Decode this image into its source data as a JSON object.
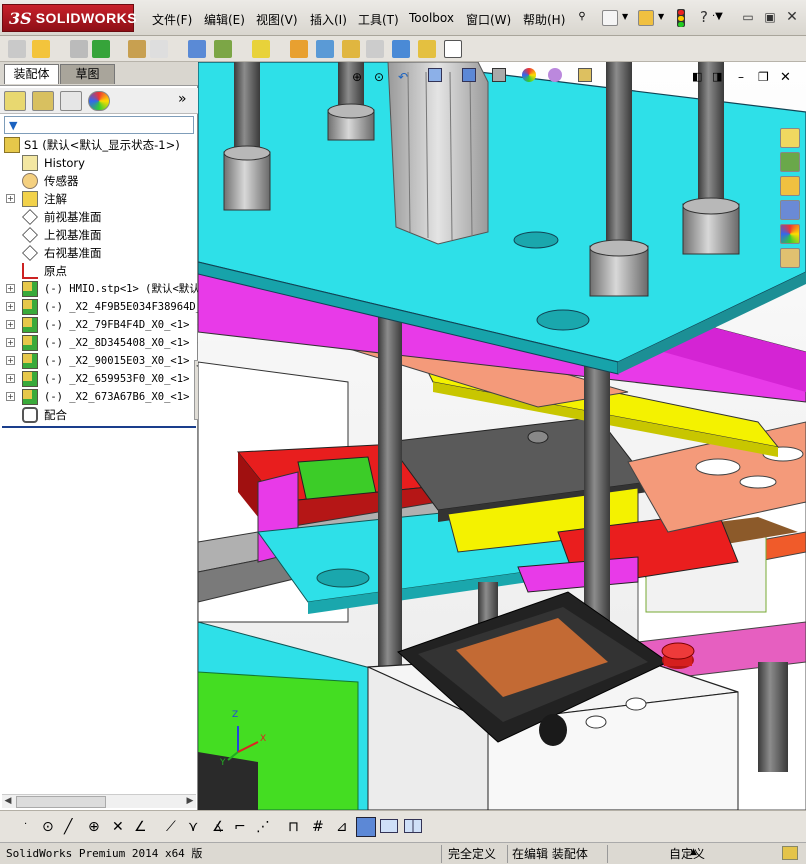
{
  "app": {
    "logo_ds": "3S",
    "logo_name": "SOLIDWORKS"
  },
  "menu": [
    {
      "id": "file",
      "label": "文件(F)"
    },
    {
      "id": "edit",
      "label": "编辑(E)"
    },
    {
      "id": "view",
      "label": "视图(V)"
    },
    {
      "id": "insert",
      "label": "插入(I)"
    },
    {
      "id": "tools",
      "label": "工具(T)"
    },
    {
      "id": "toolbox",
      "label": "Toolbox"
    },
    {
      "id": "window",
      "label": "窗口(W)"
    },
    {
      "id": "help",
      "label": "帮助(H)"
    }
  ],
  "panel": {
    "tabs": [
      "装配体",
      "草图"
    ],
    "filter_icon": "funnel-icon",
    "collapse_glyph": "»"
  },
  "tree": {
    "root": "S1  (默认<默认_显示状态-1>)",
    "items": [
      {
        "label": "History",
        "icon": "history-icon",
        "expandable": false
      },
      {
        "label": "传感器",
        "icon": "sensor-icon",
        "expandable": false
      },
      {
        "label": "注解",
        "icon": "annotation-icon",
        "expandable": true
      },
      {
        "label": "前视基准面",
        "icon": "plane-icon",
        "expandable": false
      },
      {
        "label": "上视基准面",
        "icon": "plane-icon",
        "expandable": false
      },
      {
        "label": "右视基准面",
        "icon": "plane-icon",
        "expandable": false
      },
      {
        "label": "原点",
        "icon": "origin-icon",
        "expandable": false
      },
      {
        "label": "(-) HMIO.stp<1> (默认<默认",
        "icon": "part-icon",
        "expandable": true
      },
      {
        "label": "(-) _X2_4F9B5E034F38964D_",
        "icon": "part-icon",
        "expandable": true
      },
      {
        "label": "(-) _X2_79FB4F4D_X0_<1> (",
        "icon": "part-icon",
        "expandable": true
      },
      {
        "label": "(-) _X2_8D345408_X0_<1> (",
        "icon": "part-icon",
        "expandable": true
      },
      {
        "label": "(-) _X2_90015E03_X0_<1> (",
        "icon": "part-icon",
        "expandable": true
      },
      {
        "label": "(-) _X2_659953F0_X0_<1> (",
        "icon": "part-icon",
        "expandable": true
      },
      {
        "label": "(-) _X2_673A67B6_X0_<1> (",
        "icon": "part-icon",
        "expandable": true
      },
      {
        "label": "配合",
        "icon": "mates-icon",
        "expandable": false
      }
    ]
  },
  "statusbar": {
    "product": "SolidWorks Premium 2014 x64 版",
    "definition": "完全定义",
    "editing": "在编辑 装配体",
    "units": "自定义",
    "arrow": "▲"
  },
  "axes": {
    "x": "X",
    "y": "Y",
    "z": "Z"
  },
  "colors": {
    "cyan_plate": "#2ee0e8",
    "magenta_plate": "#e83ae8",
    "yellow_plate": "#f4f200",
    "red_block": "#f02222",
    "green_block": "#3ccc28",
    "salmon_plate": "#f49a7a",
    "lcd_orange": "#c36a34"
  }
}
